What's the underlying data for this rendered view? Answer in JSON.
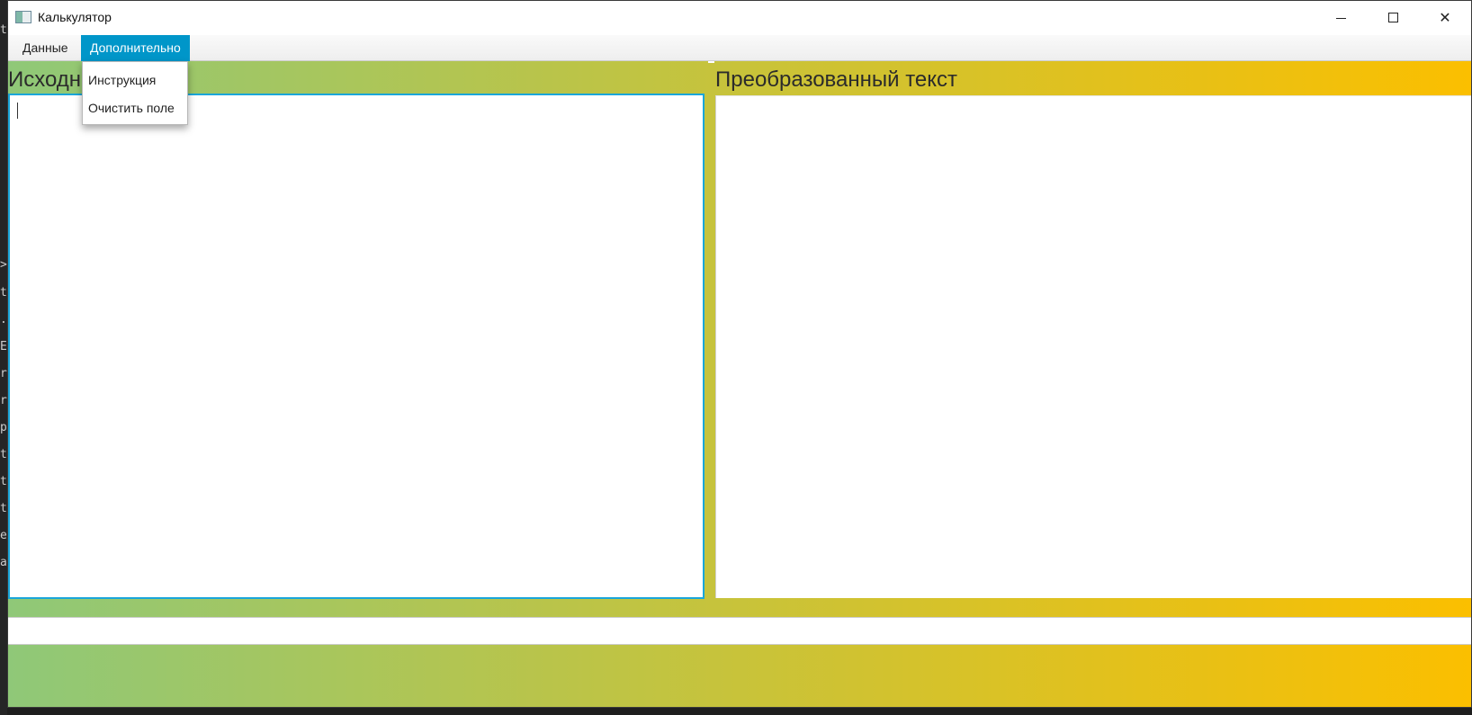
{
  "window": {
    "title": "Калькулятор",
    "controls": {
      "minimize": "minimize-icon",
      "maximize": "maximize-icon",
      "close": "close-icon"
    }
  },
  "menubar": {
    "items": [
      {
        "label": "Данные"
      },
      {
        "label": "Дополнительно",
        "active": true
      }
    ]
  },
  "dropdown": {
    "items": [
      {
        "label": "Инструкция"
      },
      {
        "label": "Очистить поле"
      }
    ]
  },
  "panels": {
    "source_label": "Исходный текст",
    "result_label": "Преобразованный текст",
    "source_value": "",
    "result_value": ""
  },
  "colors": {
    "menu_active": "#0096c9",
    "focus_border": "#1aa6d9",
    "gradient_start": "#8fc878",
    "gradient_end": "#fbbf00"
  },
  "background_strip": {
    "chars": [
      "t",
      ">",
      "t",
      ".c",
      "E",
      "r",
      "r",
      "p",
      "t",
      "t",
      "t",
      "e",
      "at"
    ]
  }
}
